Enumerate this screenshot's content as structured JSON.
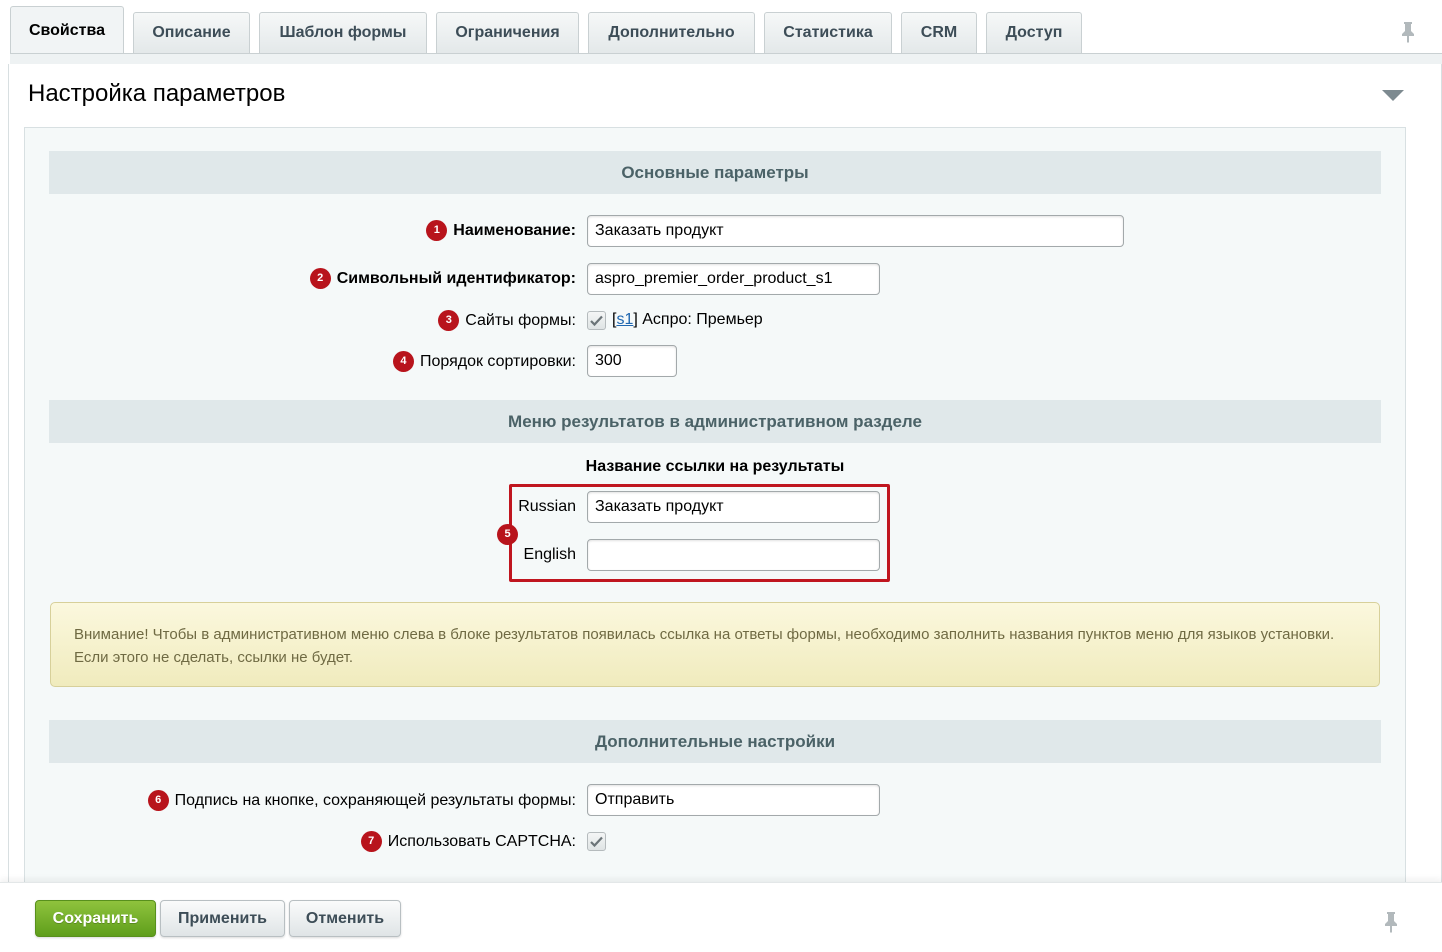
{
  "tabs": [
    {
      "label": "Свойства",
      "active": true
    },
    {
      "label": "Описание"
    },
    {
      "label": "Шаблон формы"
    },
    {
      "label": "Ограничения"
    },
    {
      "label": "Дополнительно"
    },
    {
      "label": "Статистика"
    },
    {
      "label": "CRM"
    },
    {
      "label": "Доступ"
    }
  ],
  "panel": {
    "title": "Настройка параметров"
  },
  "sections": {
    "main": "Основные параметры",
    "menu": "Меню результатов в административном разделе",
    "extra": "Дополнительные настройки"
  },
  "fields": {
    "name": {
      "badge": "1",
      "label": "Наименование:",
      "value": "Заказать продукт"
    },
    "code": {
      "badge": "2",
      "label": "Символьный идентификатор:",
      "value": "aspro_premier_order_product_s1"
    },
    "sites": {
      "badge": "3",
      "label": "Сайты формы:",
      "checked": true,
      "site_open": "[",
      "site_id": "s1",
      "site_close": "] Аспро: Премьер"
    },
    "sort": {
      "badge": "4",
      "label": "Порядок сортировки:",
      "value": "300"
    },
    "menu_link": {
      "title": "Название ссылки на результаты",
      "badge": "5",
      "russian_label": "Russian",
      "russian_value": "Заказать продукт",
      "english_label": "English",
      "english_value": ""
    },
    "button_caption": {
      "badge": "6",
      "label": "Подпись на кнопке, сохраняющей результаты формы:",
      "value": "Отправить"
    },
    "captcha": {
      "badge": "7",
      "label": "Использовать CAPTCHA:",
      "checked": true
    }
  },
  "notice": "Внимание! Чтобы в административном меню слева в блоке результатов появилась ссылка на ответы формы, необходимо заполнить названия пунктов меню для языков установки. Если этого не сделать, ссылки не будет.",
  "footer": {
    "save": "Сохранить",
    "apply": "Применить",
    "cancel": "Отменить"
  },
  "colors": {
    "badge": "#b8141c",
    "highlight": "#c0161f",
    "primary_button": "#6aa823",
    "link": "#2067b0"
  },
  "icons": [
    "pin-icon",
    "collapse-arrow-icon",
    "checkmark-icon"
  ]
}
